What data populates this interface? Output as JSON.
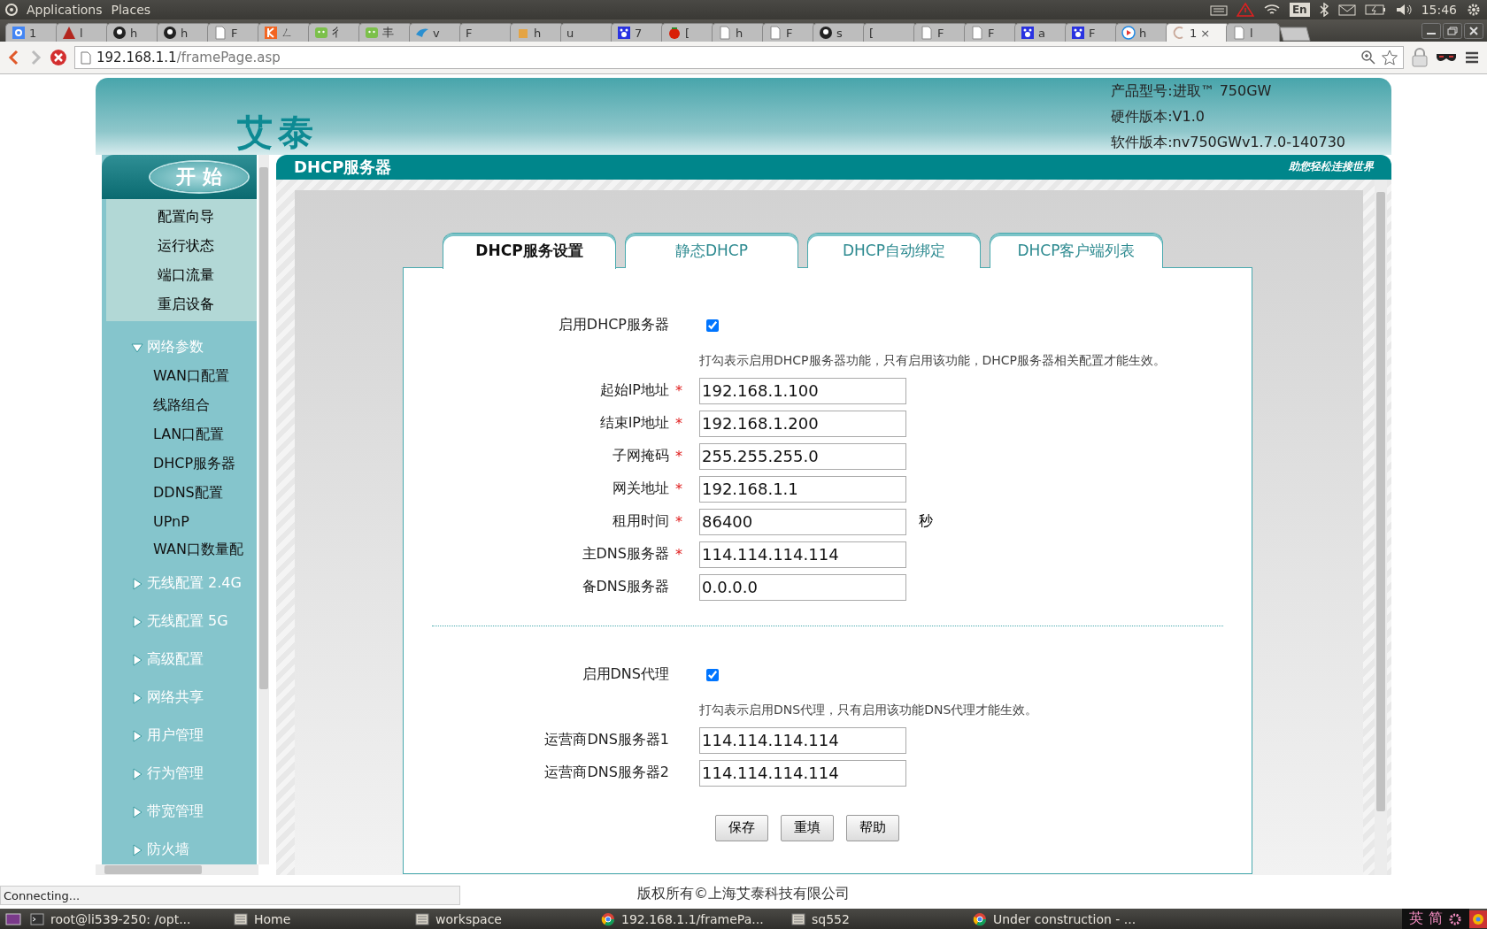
{
  "system_bar": {
    "menus": [
      "Applications",
      "Places"
    ],
    "keyboard_layout": "En",
    "clock": "15:46"
  },
  "browser": {
    "tabs": [
      {
        "label": "1",
        "selected": false
      },
      {
        "label": "l",
        "selected": false
      },
      {
        "label": "h",
        "selected": false
      },
      {
        "label": "h",
        "selected": false
      },
      {
        "label": "F",
        "selected": false
      },
      {
        "label": "ㄥ",
        "selected": false
      },
      {
        "label": "彳",
        "selected": false
      },
      {
        "label": "丰",
        "selected": false
      },
      {
        "label": "v",
        "selected": false
      },
      {
        "label": "F",
        "selected": false
      },
      {
        "label": "h",
        "selected": false
      },
      {
        "label": "u",
        "selected": false
      },
      {
        "label": "7",
        "selected": false
      },
      {
        "label": "[",
        "selected": false
      },
      {
        "label": "h",
        "selected": false
      },
      {
        "label": "F",
        "selected": false
      },
      {
        "label": "s",
        "selected": false
      },
      {
        "label": "[",
        "selected": false
      },
      {
        "label": "F",
        "selected": false
      },
      {
        "label": "F",
        "selected": false
      },
      {
        "label": "a",
        "selected": false
      },
      {
        "label": "F",
        "selected": false
      },
      {
        "label": "h",
        "selected": false
      },
      {
        "label": "1",
        "selected": true,
        "close": "×"
      },
      {
        "label": "l",
        "selected": false
      }
    ],
    "url_host": "192.168.1.1",
    "url_path": "/framePage.asp",
    "status": "Connecting..."
  },
  "router": {
    "logo": "艾泰",
    "info": [
      "产品型号:进取™ 750GW",
      "硬件版本:V1.0",
      "软件版本:nv750GWv1.7.0-140730"
    ],
    "section_title": "DHCP服务器",
    "slogan": "助您轻松连接世界",
    "start": "开 始",
    "quick_menu": [
      "配置向导",
      "运行状态",
      "端口流量",
      "重启设备"
    ],
    "nav": [
      {
        "label": "网络参数",
        "expanded": true,
        "children": [
          {
            "label": "WAN口配置"
          },
          {
            "label": "线路组合"
          },
          {
            "label": "LAN口配置"
          },
          {
            "label": "DHCP服务器"
          },
          {
            "label": "DDNS配置"
          },
          {
            "label": "UPnP"
          },
          {
            "label": "WAN口数量配"
          }
        ]
      },
      {
        "label": "无线配置 2.4G",
        "expanded": false
      },
      {
        "label": "无线配置 5G",
        "expanded": false
      },
      {
        "label": "高级配置",
        "expanded": false
      },
      {
        "label": "网络共享",
        "expanded": false
      },
      {
        "label": "用户管理",
        "expanded": false
      },
      {
        "label": "行为管理",
        "expanded": false
      },
      {
        "label": "带宽管理",
        "expanded": false
      },
      {
        "label": "防火墙",
        "expanded": false
      }
    ],
    "tabs": [
      {
        "label": "DHCP服务设置",
        "selected": true
      },
      {
        "label": "静态DHCP",
        "selected": false
      },
      {
        "label": "DHCP自动绑定",
        "selected": false
      },
      {
        "label": "DHCP客户端列表",
        "selected": false
      }
    ],
    "form": [
      {
        "kind": "checkbox",
        "label": "启用DHCP服务器",
        "checked": true,
        "hint": "打勾表示启用DHCP服务器功能，只有启用该功能，DHCP服务器相关配置才能生效。"
      },
      {
        "kind": "field",
        "label": "起始IP地址",
        "mark": "*",
        "value": "192.168.1.100"
      },
      {
        "kind": "field",
        "label": "结束IP地址",
        "mark": "*",
        "value": "192.168.1.200"
      },
      {
        "kind": "field",
        "label": "子网掩码",
        "mark": "*",
        "value": "255.255.255.0"
      },
      {
        "kind": "field",
        "label": "网关地址",
        "mark": "*",
        "value": "192.168.1.1"
      },
      {
        "kind": "field",
        "label": "租用时间",
        "mark": "*",
        "value": "86400",
        "unit": "秒"
      },
      {
        "kind": "field",
        "label": "主DNS服务器",
        "mark": "*",
        "value": "114.114.114.114"
      },
      {
        "kind": "field",
        "label": "备DNS服务器",
        "value": "0.0.0.0"
      },
      {
        "kind": "divider"
      },
      {
        "kind": "checkbox",
        "label": "启用DNS代理",
        "checked": true,
        "hint": "打勾表示启用DNS代理，只有启用该功能DNS代理才能生效。"
      },
      {
        "kind": "field",
        "label": "运营商DNS服务器1",
        "value": "114.114.114.114"
      },
      {
        "kind": "field",
        "label": "运营商DNS服务器2",
        "value": "114.114.114.114"
      }
    ],
    "buttons": [
      "保存",
      "重填",
      "帮助"
    ],
    "copyright": "版权所有©上海艾泰科技有限公司"
  },
  "taskbar": {
    "items": [
      {
        "label": "root@li539-250: /opt..."
      },
      {
        "label": "Home"
      },
      {
        "label": "workspace"
      },
      {
        "label": "192.168.1.1/framePa..."
      },
      {
        "label": "sq552"
      },
      {
        "label": "Under construction - ..."
      }
    ],
    "tray": [
      "英",
      "简"
    ]
  }
}
